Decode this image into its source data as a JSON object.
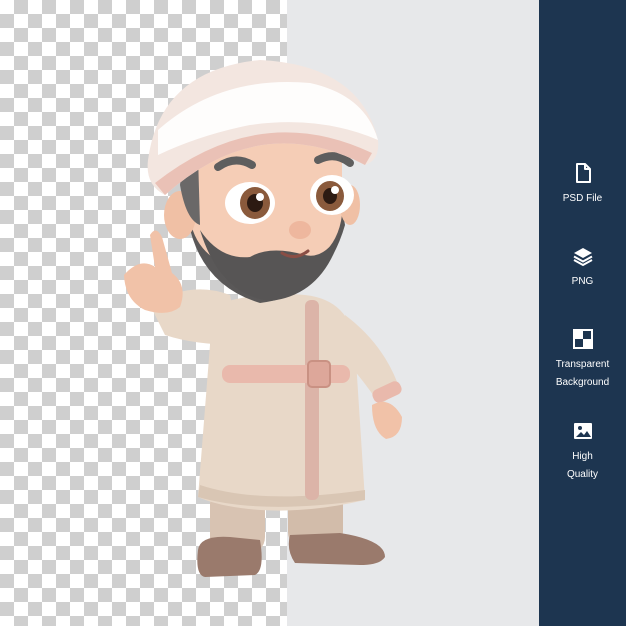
{
  "panels": {
    "checker_color": "#cfcfcf",
    "gray_color": "#e7e8ea",
    "sidebar_color": "#1d3550"
  },
  "features": [
    {
      "icon": "file-icon",
      "label": "PSD File"
    },
    {
      "icon": "layers-icon",
      "label": "PNG"
    },
    {
      "icon": "transparency-grid-icon",
      "label": "Transparent\nBackground"
    },
    {
      "icon": "image-icon",
      "label": "High\nQuality"
    }
  ]
}
